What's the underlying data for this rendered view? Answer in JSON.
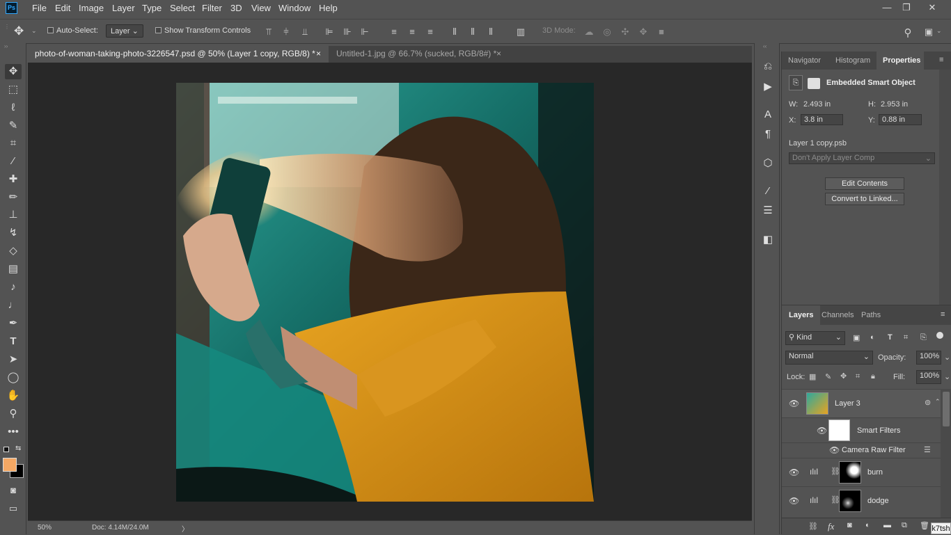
{
  "app": {
    "badge": "Ps"
  },
  "menu": [
    "File",
    "Edit",
    "Image",
    "Layer",
    "Type",
    "Select",
    "Filter",
    "3D",
    "View",
    "Window",
    "Help"
  ],
  "window_controls": {
    "minimize": "—",
    "restore": "❐",
    "close": "✕"
  },
  "options": {
    "auto_select_label": "Auto-Select:",
    "auto_select_value": "Layer",
    "show_transform_label": "Show Transform Controls",
    "mode_3d_label": "3D Mode:"
  },
  "tabs": [
    {
      "label": "photo-of-woman-taking-photo-3226547.psd @ 50% (Layer 1 copy, RGB/8) *",
      "close": "×"
    },
    {
      "label": "Untitled-1.jpg @ 66.7% (sucked, RGB/8#) *",
      "close": "×"
    }
  ],
  "status": {
    "zoom": "50%",
    "doc": "Doc: 4.14M/24.0M",
    "arrow": "〉"
  },
  "properties": {
    "tabs": [
      "Navigator",
      "Histogram",
      "Properties"
    ],
    "title": "Embedded Smart Object",
    "w_label": "W:",
    "w_value": "2.493 in",
    "h_label": "H:",
    "h_value": "2.953 in",
    "x_label": "X:",
    "x_value": "3.8 in",
    "y_label": "Y:",
    "y_value": "0.88 in",
    "filename": "Layer 1 copy.psb",
    "layer_comp": "Don't Apply Layer Comp",
    "edit_contents": "Edit Contents",
    "convert_linked": "Convert to Linked..."
  },
  "layers_panel": {
    "tabs": [
      "Layers",
      "Channels",
      "Paths"
    ],
    "filter_kind": "Kind",
    "blend_mode": "Normal",
    "opacity_label": "Opacity:",
    "opacity_value": "100%",
    "lock_label": "Lock:",
    "fill_label": "Fill:",
    "fill_value": "100%",
    "rows": [
      {
        "name": "Layer 3"
      },
      {
        "name": "Smart Filters"
      },
      {
        "name": "Camera Raw Filter"
      },
      {
        "name": "burn"
      },
      {
        "name": "dodge"
      }
    ],
    "footer_fx": "fx"
  },
  "overlay_tag": "k7tsh",
  "colors": {
    "foreground": "#f4a864",
    "background": "#000000",
    "accent": "#31a8ff"
  }
}
